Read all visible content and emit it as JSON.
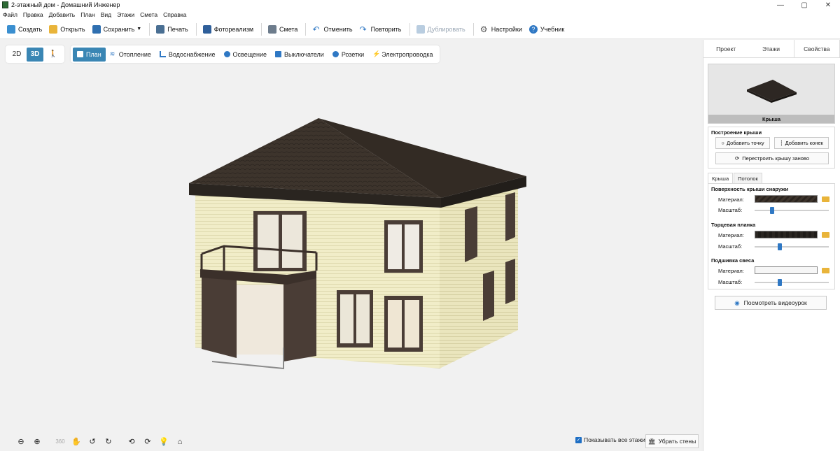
{
  "window": {
    "title": "2-этажный дом - Домашний Инженер",
    "controls": {
      "minimize": "—",
      "maximize": "▢",
      "close": "✕"
    }
  },
  "menu": [
    "Файл",
    "Правка",
    "Добавить",
    "План",
    "Вид",
    "Этажи",
    "Смета",
    "Справка"
  ],
  "toolbar": {
    "create": "Создать",
    "open": "Открыть",
    "save": "Сохранить",
    "print": "Печать",
    "photorealism": "Фотореализм",
    "estimate": "Смета",
    "undo": "Отменить",
    "redo": "Повторить",
    "duplicate": "Дублировать",
    "settings": "Настройки",
    "tutorial": "Учебник"
  },
  "view_modes": {
    "mode_2d": "2D",
    "mode_3d": "3D",
    "walk_icon": "walk-icon",
    "active": "3D"
  },
  "plan_tabs": [
    "План",
    "Отопление",
    "Водоснабжение",
    "Освещение",
    "Выключатели",
    "Розетки",
    "Электропроводка"
  ],
  "bottom": {
    "tools": [
      "zoom-out-icon",
      "zoom-in-icon",
      "rotate-360-icon",
      "hand-pan-icon",
      "rotate-left-icon",
      "rotate-right-icon",
      "orbit-left-icon",
      "orbit-right-icon",
      "light-bulb-icon",
      "home-icon"
    ],
    "show_all_floors": "Показывать все этажи",
    "show_all_floors_checked": true,
    "remove_walls": "Убрать стены"
  },
  "panel": {
    "tabs": [
      "Проект",
      "Этажи",
      "Свойства"
    ],
    "active_tab": "Свойства",
    "preview_label": "Крыша",
    "roof_build": {
      "title": "Построение крыши",
      "add_point": "Добавить точку",
      "add_ridge": "Добавить конек",
      "rebuild": "Перестроить крышу заново"
    },
    "sub_tabs": [
      "Крыша",
      "Потолок"
    ],
    "outer_surface": {
      "title": "Поверхность крыши снаружи",
      "material_label": "Материал:",
      "scale_label": "Масштаб:",
      "scale": 0.22
    },
    "fascia": {
      "title": "Торцевая планка",
      "material_label": "Материал:",
      "scale_label": "Масштаб:",
      "scale": 0.33
    },
    "soffit": {
      "title": "Подшивка свеса",
      "material_label": "Материал:",
      "scale_label": "Масштаб:",
      "scale": 0.33
    },
    "video_lesson": "Посмотреть видеоурок"
  },
  "colors": {
    "accent": "#3a86b4",
    "roof": "#3d342c",
    "wall": "#f1edc8",
    "frame": "#4a3d36"
  }
}
